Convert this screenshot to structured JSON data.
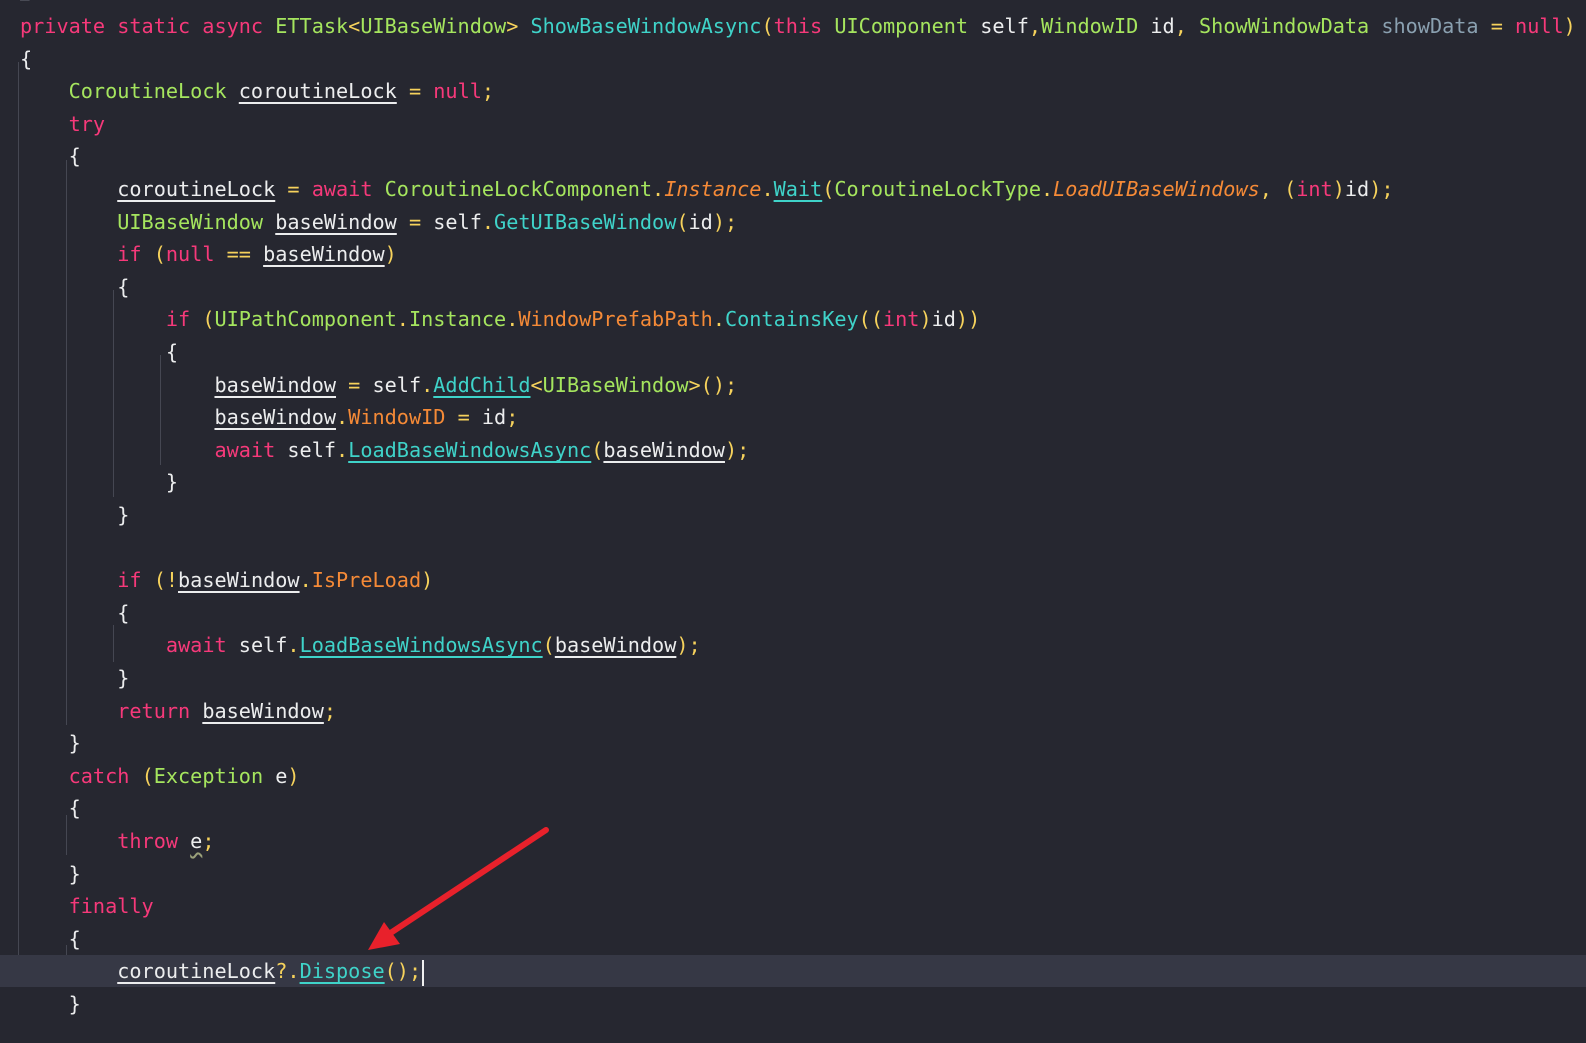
{
  "editor": {
    "top_fragment": "□ . . . . . . . .",
    "lines": [
      [
        [
          "k",
          "private static async "
        ],
        [
          "t",
          "ETTask"
        ],
        [
          "y",
          "<"
        ],
        [
          "t",
          "UIBaseWindow"
        ],
        [
          "y",
          "> "
        ],
        [
          "m",
          "ShowBaseWindowAsync"
        ],
        [
          "y",
          "("
        ],
        [
          "k",
          "this "
        ],
        [
          "t",
          "UIComponent "
        ],
        [
          "w",
          "self"
        ],
        [
          "y",
          ","
        ],
        [
          "t",
          "WindowID "
        ],
        [
          "w",
          "id"
        ],
        [
          "y",
          ", "
        ],
        [
          "t",
          "ShowWindowData "
        ],
        [
          "g",
          "showData"
        ],
        [
          "y",
          " = "
        ],
        [
          "k",
          "null"
        ],
        [
          "y",
          ")"
        ]
      ],
      [
        [
          "w",
          "{"
        ]
      ],
      [
        [
          "t",
          "    CoroutineLock "
        ],
        [
          "wu",
          "coroutineLock"
        ],
        [
          "y",
          " = "
        ],
        [
          "k",
          "null"
        ],
        [
          "y",
          ";"
        ]
      ],
      [
        [
          "k",
          "    try"
        ]
      ],
      [
        [
          "w",
          "    {"
        ]
      ],
      [
        [
          "wu",
          "        coroutineLock"
        ],
        [
          "y",
          " = "
        ],
        [
          "k",
          "await "
        ],
        [
          "t",
          "CoroutineLockComponent"
        ],
        [
          "y",
          "."
        ],
        [
          "fi",
          "Instance"
        ],
        [
          "y",
          "."
        ],
        [
          "mu",
          "Wait"
        ],
        [
          "y",
          "("
        ],
        [
          "t",
          "CoroutineLockType"
        ],
        [
          "y",
          "."
        ],
        [
          "fi",
          "LoadUIBaseWindows"
        ],
        [
          "y",
          ", ("
        ],
        [
          "k",
          "int"
        ],
        [
          "y",
          ")"
        ],
        [
          "w",
          "id"
        ],
        [
          "y",
          ");"
        ]
      ],
      [
        [
          "t",
          "        UIBaseWindow "
        ],
        [
          "wu",
          "baseWindow"
        ],
        [
          "y",
          " = "
        ],
        [
          "w",
          "self"
        ],
        [
          "y",
          "."
        ],
        [
          "m",
          "GetUIBaseWindow"
        ],
        [
          "y",
          "("
        ],
        [
          "w",
          "id"
        ],
        [
          "y",
          ");"
        ]
      ],
      [
        [
          "k",
          "        if "
        ],
        [
          "y",
          "("
        ],
        [
          "k",
          "null"
        ],
        [
          "y",
          " == "
        ],
        [
          "wu",
          "baseWindow"
        ],
        [
          "y",
          ")"
        ]
      ],
      [
        [
          "w",
          "        {"
        ]
      ],
      [
        [
          "k",
          "            if "
        ],
        [
          "y",
          "("
        ],
        [
          "t",
          "UIPathComponent"
        ],
        [
          "y",
          "."
        ],
        [
          "t",
          "Instance"
        ],
        [
          "y",
          "."
        ],
        [
          "f",
          "WindowPrefabPath"
        ],
        [
          "y",
          "."
        ],
        [
          "m",
          "ContainsKey"
        ],
        [
          "y",
          "(("
        ],
        [
          "k",
          "int"
        ],
        [
          "y",
          ")"
        ],
        [
          "w",
          "id"
        ],
        [
          "y",
          "))"
        ]
      ],
      [
        [
          "w",
          "            {"
        ]
      ],
      [
        [
          "wu",
          "                baseWindow"
        ],
        [
          "y",
          " = "
        ],
        [
          "w",
          "self"
        ],
        [
          "y",
          "."
        ],
        [
          "mu",
          "AddChild"
        ],
        [
          "y",
          "<"
        ],
        [
          "t",
          "UIBaseWindow"
        ],
        [
          "y",
          ">();"
        ]
      ],
      [
        [
          "wu",
          "                baseWindow"
        ],
        [
          "y",
          "."
        ],
        [
          "f",
          "WindowID"
        ],
        [
          "y",
          " = "
        ],
        [
          "w",
          "id"
        ],
        [
          "y",
          ";"
        ]
      ],
      [
        [
          "k",
          "                await "
        ],
        [
          "w",
          "self"
        ],
        [
          "y",
          "."
        ],
        [
          "mu",
          "LoadBaseWindowsAsync"
        ],
        [
          "y",
          "("
        ],
        [
          "wu",
          "baseWindow"
        ],
        [
          "y",
          ");"
        ]
      ],
      [
        [
          "w",
          "            }"
        ]
      ],
      [
        [
          "w",
          "        }"
        ]
      ],
      [
        [
          "w",
          ""
        ]
      ],
      [
        [
          "k",
          "        if "
        ],
        [
          "y",
          "(!"
        ],
        [
          "wu",
          "baseWindow"
        ],
        [
          "y",
          "."
        ],
        [
          "f",
          "IsPreLoad"
        ],
        [
          "y",
          ")"
        ]
      ],
      [
        [
          "w",
          "        {"
        ]
      ],
      [
        [
          "k",
          "            await "
        ],
        [
          "w",
          "self"
        ],
        [
          "y",
          "."
        ],
        [
          "mu",
          "LoadBaseWindowsAsync"
        ],
        [
          "y",
          "("
        ],
        [
          "wu",
          "baseWindow"
        ],
        [
          "y",
          ");"
        ]
      ],
      [
        [
          "w",
          "        }"
        ]
      ],
      [
        [
          "k",
          "        return "
        ],
        [
          "wu",
          "baseWindow"
        ],
        [
          "y",
          ";"
        ]
      ],
      [
        [
          "w",
          "    }"
        ]
      ],
      [
        [
          "k",
          "    catch "
        ],
        [
          "y",
          "("
        ],
        [
          "t",
          "Exception "
        ],
        [
          "w",
          "e"
        ],
        [
          "y",
          ")"
        ]
      ],
      [
        [
          "w",
          "    {"
        ]
      ],
      [
        [
          "k",
          "        throw "
        ],
        [
          "ww",
          "e"
        ],
        [
          "y",
          ";"
        ]
      ],
      [
        [
          "w",
          "    }"
        ]
      ],
      [
        [
          "k",
          "    finally"
        ]
      ],
      [
        [
          "w",
          "    {"
        ]
      ],
      [
        [
          "wu",
          "        coroutineLock"
        ],
        [
          "y",
          "?."
        ],
        [
          "mu",
          "Dispose"
        ],
        [
          "y",
          "();"
        ]
      ],
      [
        [
          "w",
          "    }"
        ]
      ]
    ],
    "current_line": 29
  },
  "annotation": {
    "arrow_color": "#E8212B"
  }
}
